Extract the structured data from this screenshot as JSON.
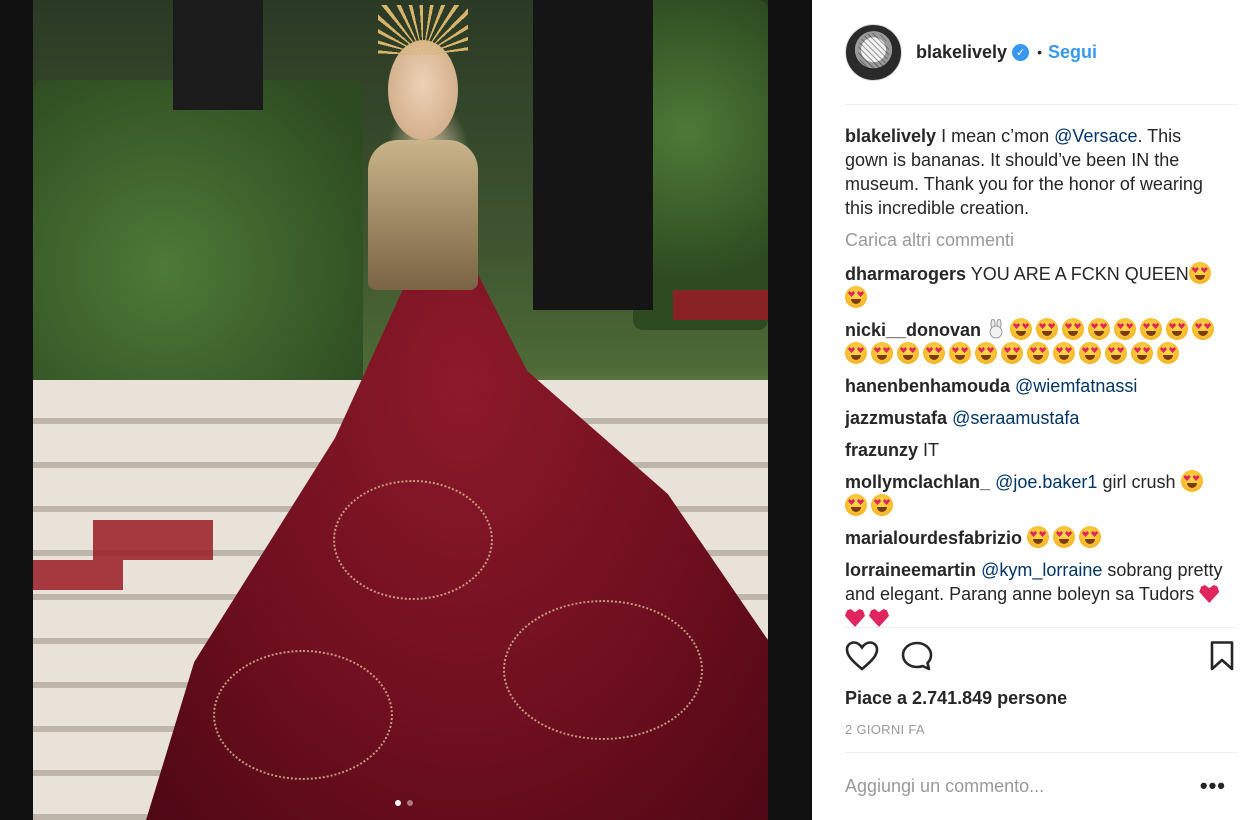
{
  "post": {
    "username": "blakelively",
    "separator": "•",
    "follow_label": "Segui",
    "verified_icon": "verified-badge-icon"
  },
  "caption": {
    "username": "blakelively",
    "text_before": "I mean c’mon",
    "mention": "@Versace",
    "text_after": ". This gown is bananas. It should’ve been IN the museum. Thank you for the honor of wearing this incredible creation."
  },
  "load_more_label": "Carica altri commenti",
  "comments": [
    {
      "username": "dharmarogers",
      "text": "YOU ARE A FCKN QUEEN",
      "mention": "",
      "after": "",
      "emoji_count": 2,
      "bunny": false,
      "hearts": 0
    },
    {
      "username": "nicki__donovan",
      "text": "",
      "mention": "",
      "after": "",
      "emoji_count": 21,
      "bunny": true,
      "hearts": 0
    },
    {
      "username": "hanenbenhamouda",
      "text": "",
      "mention": "@wiemfatnassi",
      "after": "",
      "emoji_count": 0,
      "bunny": false,
      "hearts": 0
    },
    {
      "username": "jazzmustafa",
      "text": "",
      "mention": "@seraamustafa",
      "after": "",
      "emoji_count": 0,
      "bunny": false,
      "hearts": 0
    },
    {
      "username": "frazunzy",
      "text": "IT",
      "mention": "",
      "after": "",
      "emoji_count": 0,
      "bunny": false,
      "hearts": 0
    },
    {
      "username": "mollymclachlan_",
      "text": "",
      "mention": "@joe.baker1",
      "after": "girl crush",
      "emoji_count": 3,
      "bunny": false,
      "hearts": 0
    },
    {
      "username": "marialourdesfabrizio",
      "text": "",
      "mention": "",
      "after": "",
      "emoji_count": 3,
      "bunny": false,
      "hearts": 0
    },
    {
      "username": "lorraineemartin",
      "text": "",
      "mention": "@kym_lorraine",
      "after": "sobrang pretty and elegant. Parang anne boleyn sa Tudors",
      "emoji_count": 0,
      "bunny": false,
      "hearts": 3
    }
  ],
  "actions": {
    "like_icon": "heart-outline-icon",
    "comment_icon": "comment-bubble-icon",
    "save_icon": "bookmark-icon"
  },
  "likes_text": "Piace a 2.741.849 persone",
  "timestamp": "2 GIORNI FA",
  "add_comment_placeholder": "Aggiungi un commento...",
  "more_label": "•••",
  "carousel": {
    "total": 2,
    "active": 1
  },
  "colors": {
    "link": "#3897f0",
    "mention": "#003569",
    "muted": "#999999"
  }
}
